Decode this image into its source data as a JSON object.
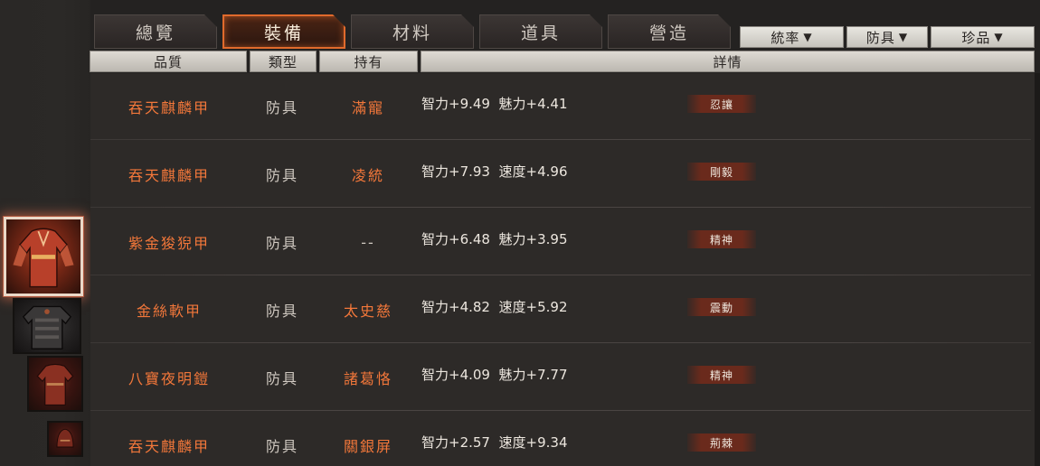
{
  "tabs": [
    {
      "label": "總覽",
      "active": false
    },
    {
      "label": "裝備",
      "active": true
    },
    {
      "label": "材料",
      "active": false
    },
    {
      "label": "道具",
      "active": false
    },
    {
      "label": "營造",
      "active": false
    }
  ],
  "filters": [
    {
      "label": "統率",
      "arrow": "▼"
    },
    {
      "label": "防具",
      "arrow": "▼"
    },
    {
      "label": "珍品",
      "arrow": "▼"
    }
  ],
  "columns": {
    "quality": "品質",
    "type": "類型",
    "owner": "持有",
    "details": "詳情"
  },
  "rows": [
    {
      "name": "吞天麒麟甲",
      "type": "防具",
      "owner": "滿寵",
      "stat1": "智力+9.49",
      "stat2": "魅力+4.41",
      "trait": "忍讓"
    },
    {
      "name": "吞天麒麟甲",
      "type": "防具",
      "owner": "凌統",
      "stat1": "智力+7.93",
      "stat2": "速度+4.96",
      "trait": "剛毅"
    },
    {
      "name": "紫金狻猊甲",
      "type": "防具",
      "owner": "--",
      "stat1": "智力+6.48",
      "stat2": "魅力+3.95",
      "trait": "精神"
    },
    {
      "name": "金絲軟甲",
      "type": "防具",
      "owner": "太史慈",
      "stat1": "智力+4.82",
      "stat2": "速度+5.92",
      "trait": "震動"
    },
    {
      "name": "八寶夜明鎧",
      "type": "防具",
      "owner": "諸葛恪",
      "stat1": "智力+4.09",
      "stat2": "魅力+7.77",
      "trait": "精神"
    },
    {
      "name": "吞天麒麟甲",
      "type": "防具",
      "owner": "關銀屏",
      "stat1": "智力+2.57",
      "stat2": "速度+9.34",
      "trait": "荊棘"
    }
  ],
  "thumbnails": [
    {
      "icon": "red-robe-armor-icon",
      "selected": true
    },
    {
      "icon": "dark-plate-armor-icon",
      "selected": false
    },
    {
      "icon": "red-robe-armor-icon",
      "selected": false
    },
    {
      "icon": "helmet-armor-icon",
      "selected": false
    }
  ],
  "colors": {
    "accent_orange": "#f2773a",
    "active_tab_border": "#e06a2c",
    "background": "#242221",
    "trait_badge": "#6a2a1c"
  }
}
